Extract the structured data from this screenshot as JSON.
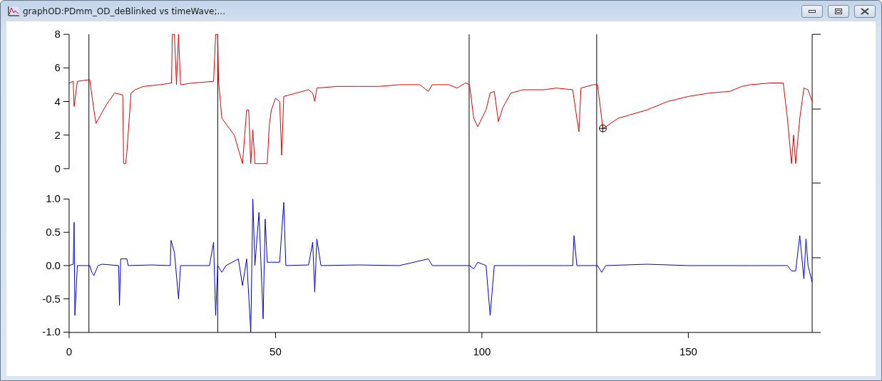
{
  "window": {
    "title": "graphOD:PDmm_OD_deBlinked vs timeWave;..."
  },
  "top_chart": {
    "chart_data": {
      "type": "line",
      "xlim": [
        0,
        180
      ],
      "ylim": [
        0,
        8
      ],
      "yticks": [
        0,
        2,
        4,
        6,
        8
      ],
      "x": [
        0,
        1,
        1.2,
        2,
        5,
        6,
        6.5,
        9,
        11,
        13,
        13.2,
        13.7,
        14,
        15,
        16,
        18,
        22,
        24.8,
        25,
        25.5,
        26,
        26.5,
        27,
        30,
        35,
        35.5,
        36,
        36.2,
        37,
        40,
        42,
        43,
        43.5,
        44,
        44.5,
        45,
        48,
        48.5,
        49,
        50,
        51,
        51.5,
        52,
        55,
        58,
        59,
        59.5,
        60,
        65,
        70,
        75,
        80,
        85,
        87,
        88,
        92,
        94,
        96,
        97,
        98,
        99,
        101,
        102,
        103,
        104,
        105,
        107,
        110,
        115,
        118,
        122,
        123,
        123.5,
        124,
        127,
        128,
        129,
        129.3,
        130,
        133,
        140,
        145,
        150,
        155,
        160,
        163,
        165,
        170,
        173,
        174,
        175,
        175.5,
        176,
        177,
        178,
        179,
        180
      ],
      "series": [
        {
          "color": "#e00000",
          "values": [
            5.1,
            5.2,
            3.7,
            5.2,
            5.3,
            3.5,
            2.7,
            3.8,
            4.5,
            4.4,
            0.3,
            0.3,
            1.0,
            4.5,
            4.7,
            4.9,
            5.0,
            5.1,
            8,
            8,
            5.0,
            8,
            5.0,
            5.1,
            5.2,
            8,
            8,
            5.2,
            3.0,
            2.0,
            0.3,
            3.5,
            3.5,
            0.3,
            2.3,
            0.3,
            0.3,
            2.6,
            3.5,
            4.2,
            4.0,
            0.8,
            4.3,
            4.5,
            4.7,
            4.5,
            4.0,
            4.8,
            4.9,
            4.9,
            4.9,
            5.0,
            5.0,
            4.6,
            5.0,
            5.0,
            4.8,
            5.1,
            5.0,
            3.0,
            2.5,
            3.5,
            4.5,
            4.6,
            2.8,
            3.6,
            4.5,
            4.7,
            4.7,
            4.8,
            4.7,
            3.0,
            2.2,
            4.8,
            5.0,
            5.0,
            3.0,
            2.4,
            2.5,
            3.0,
            3.5,
            4.0,
            4.3,
            4.5,
            4.6,
            4.9,
            5.0,
            5.1,
            5.1,
            3.0,
            0.3,
            2.0,
            0.3,
            3.0,
            4.8,
            4.7,
            4.0
          ]
        }
      ],
      "ref_lines": [
        {
          "axis": "x",
          "value": 4.8
        },
        {
          "axis": "x",
          "value": 36
        },
        {
          "axis": "x",
          "value": 96.9
        },
        {
          "axis": "x",
          "value": 127.8
        }
      ]
    }
  },
  "bottom_chart": {
    "chart_data": {
      "type": "line",
      "xlim": [
        0,
        180
      ],
      "ylim": [
        -1,
        1
      ],
      "xticks": [
        0,
        50,
        100,
        150
      ],
      "yticks": [
        {
          "value": -1,
          "label": "-1.0"
        },
        {
          "value": -0.5,
          "label": "-0.5"
        },
        {
          "value": 0,
          "label": "0.0"
        },
        {
          "value": 0.5,
          "label": "0.5"
        },
        {
          "value": 1,
          "label": "1.0"
        }
      ],
      "x": [
        0,
        1,
        1.2,
        1.4,
        2,
        5,
        5.5,
        6,
        7,
        8,
        12,
        12.2,
        12.5,
        14,
        14.3,
        20,
        24.5,
        24.7,
        25.5,
        26.5,
        27,
        34,
        35,
        35.5,
        36,
        37,
        38,
        41,
        42,
        43,
        44,
        44.5,
        45,
        46,
        47,
        47.5,
        48,
        51,
        52,
        52.5,
        58,
        59,
        59.5,
        60,
        61,
        70,
        80,
        87,
        88,
        97,
        98,
        99,
        101,
        102,
        103,
        110,
        120,
        122,
        122.3,
        123,
        128,
        129,
        130,
        140,
        150,
        165,
        170,
        174,
        175,
        176,
        177,
        178,
        178.5,
        179,
        180
      ],
      "series": [
        {
          "color": "#0000d0",
          "values": [
            0,
            0.02,
            0.65,
            -0.75,
            0,
            0,
            -0.1,
            -0.15,
            0,
            0.02,
            0,
            -0.6,
            0.1,
            0.1,
            0,
            0.01,
            0,
            0.38,
            0.2,
            -0.5,
            0,
            0,
            0.35,
            -0.75,
            0,
            -0.1,
            0,
            0.1,
            -0.3,
            0.1,
            -1.0,
            1.0,
            0,
            0.8,
            -0.8,
            0.7,
            0.05,
            0.05,
            0.95,
            0,
            0.01,
            0.35,
            -0.4,
            0.4,
            0,
            0.01,
            0,
            0.1,
            0,
            0,
            -0.05,
            0.05,
            0,
            -0.75,
            0,
            0,
            0,
            0,
            0.45,
            0,
            0,
            -0.1,
            0,
            0.02,
            0,
            0,
            0,
            0,
            -0.08,
            -0.08,
            0.45,
            -0.2,
            0.4,
            0,
            -0.25
          ]
        }
      ]
    }
  }
}
